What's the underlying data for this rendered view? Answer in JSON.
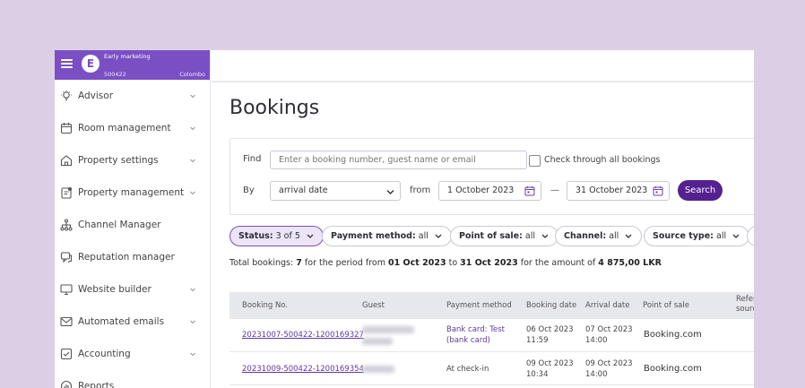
{
  "brand": {
    "initial": "E",
    "name": "Early marketing",
    "property_id": "500422",
    "city": "Colombo"
  },
  "sidebar": {
    "items": [
      {
        "label": "Advisor",
        "icon": "lightbulb-icon",
        "has_chevron": true
      },
      {
        "label": "Room management",
        "icon": "calendar-icon",
        "has_chevron": true
      },
      {
        "label": "Property settings",
        "icon": "home-icon",
        "has_chevron": true
      },
      {
        "label": "Property management",
        "icon": "clipboard-icon",
        "has_chevron": true
      },
      {
        "label": "Channel Manager",
        "icon": "network-icon",
        "has_chevron": false
      },
      {
        "label": "Reputation manager",
        "icon": "chat-icon",
        "has_chevron": false
      },
      {
        "label": "Website builder",
        "icon": "monitor-icon",
        "has_chevron": true
      },
      {
        "label": "Automated emails",
        "icon": "mail-icon",
        "has_chevron": true
      },
      {
        "label": "Accounting",
        "icon": "checklist-icon",
        "has_chevron": true
      },
      {
        "label": "Reports",
        "icon": "chart-icon",
        "has_chevron": false
      }
    ]
  },
  "page": {
    "title": "Bookings"
  },
  "filters": {
    "find_label": "Find",
    "find_placeholder": "Enter a booking number, guest name or email",
    "check_label": "Check through all bookings",
    "by_label": "By",
    "by_value": "arrival date",
    "from_label": "from",
    "date_from": "1 October 2023",
    "date_to": "31 October 2023",
    "search_label": "Search"
  },
  "chips": [
    {
      "key": "Status:",
      "value": "3 of 5"
    },
    {
      "key": "Payment method:",
      "value": "all"
    },
    {
      "key": "Point of sale:",
      "value": "all"
    },
    {
      "key": "Channel:",
      "value": "all"
    },
    {
      "key": "Source type:",
      "value": "all"
    }
  ],
  "summary": {
    "prefix": "Total bookings:",
    "count": "7",
    "period_text": "for the period from",
    "from": "01 Oct 2023",
    "to_text": "to",
    "to": "31 Oct 2023",
    "amount_text": "for the amount of",
    "amount": "4 875,00 LKR"
  },
  "table": {
    "columns": [
      "Booking No.",
      "Guest",
      "Payment method",
      "Booking date",
      "Arrival date",
      "Point of sale",
      "Reference source"
    ],
    "rows": [
      {
        "booking_no": "20231007-500422-1200169327",
        "payment_line1": "Bank card: Test",
        "payment_line2": "(bank card)",
        "booking_date": "06 Oct 2023",
        "booking_time": "11:59",
        "arrival_date": "07 Oct 2023",
        "arrival_time": "14:00",
        "point_of_sale": "Booking.com"
      },
      {
        "booking_no": "20231009-500422-1200169354",
        "payment_line1": "At check-in",
        "payment_line2": "",
        "booking_date": "09 Oct 2023",
        "booking_time": "10:34",
        "arrival_date": "09 Oct 2023",
        "arrival_time": "14:00",
        "point_of_sale": "Booking.com"
      }
    ]
  },
  "colors": {
    "brand": "#7b4fc4",
    "primary_button": "#55208f",
    "background": "#dccfe5"
  }
}
